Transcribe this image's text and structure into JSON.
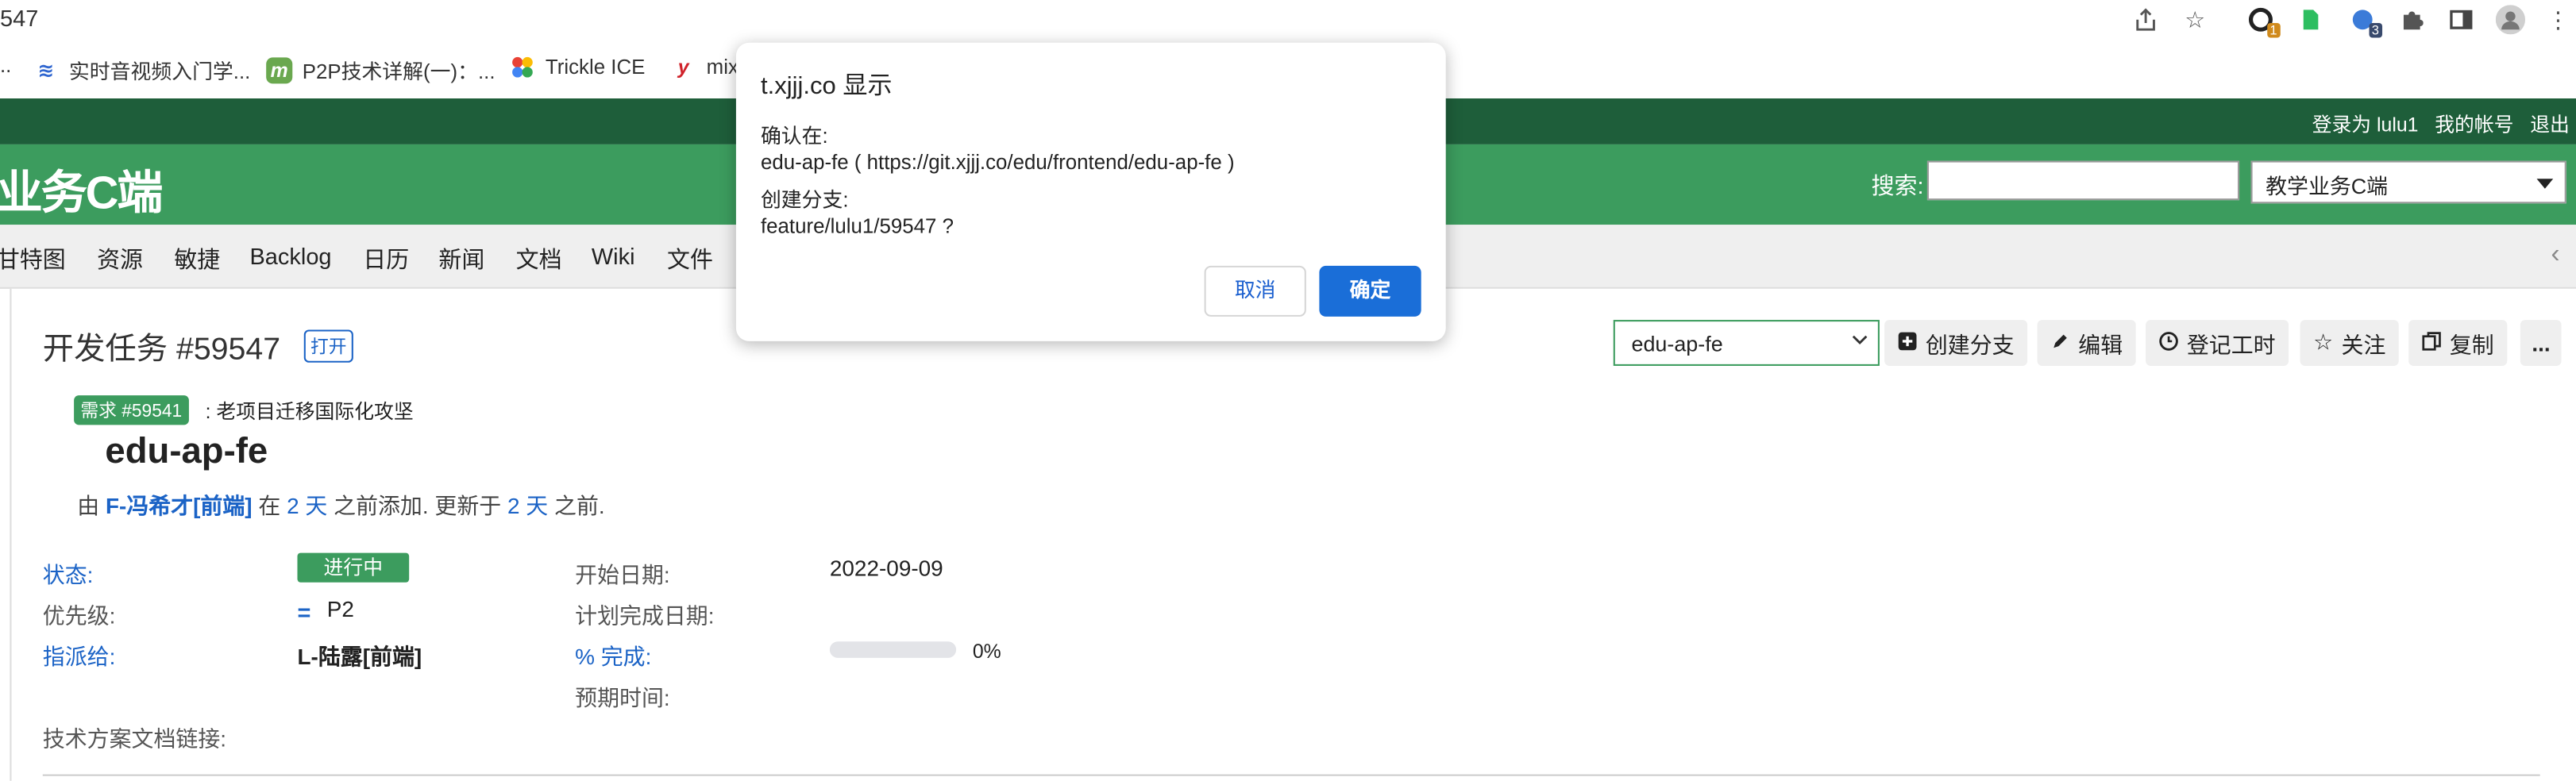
{
  "browser": {
    "url_fragment": "547",
    "extension_badges": [
      "1",
      "3"
    ]
  },
  "bookmarks": [
    {
      "label": "实时音视频入门学...",
      "icon": "layers-icon"
    },
    {
      "label": "P2P技术详解(一)：...",
      "icon": "m-logo-icon"
    },
    {
      "label": "Trickle ICE",
      "icon": "webrtc-logo-icon"
    },
    {
      "label": "mix",
      "icon": "y-logo-icon"
    }
  ],
  "account_bar": {
    "logged_in_as": "登录为 lulu1",
    "my_account": "我的帐号",
    "logout": "退出"
  },
  "header": {
    "project_title": "业务C端",
    "search_label": "搜索:",
    "search_value": "",
    "project_jump": "教学业务C端"
  },
  "main_menu": [
    "甘特图",
    "资源",
    "敏捷",
    "Backlog",
    "日历",
    "新闻",
    "文档",
    "Wiki",
    "文件"
  ],
  "issue": {
    "title": "开发任务 #59547",
    "status_tag": "打开",
    "parent_badge": "需求 #59541",
    "parent_subject": ": 老项目迁移国际化攻坚",
    "subject": "edu-ap-fe",
    "author_prefix": "由",
    "author": "F-冯希才[前端]",
    "added_prefix": "在",
    "added_ago": "2 天",
    "added_suffix": "之前添加. 更新于",
    "updated_ago": "2 天",
    "updated_suffix": "之前."
  },
  "actions": {
    "branch_select": "edu-ap-fe",
    "create_branch": "创建分支",
    "edit": "编辑",
    "log_time": "登记工时",
    "watch": "关注",
    "copy": "复制",
    "more": "..."
  },
  "attributes": {
    "status_label": "状态:",
    "status_value": "进行中",
    "priority_label": "优先级:",
    "priority_value": "P2",
    "assignee_label": "指派给:",
    "assignee_value": "L-陆露[前端]",
    "tech_doc_label": "技术方案文档链接:",
    "start_date_label": "开始日期:",
    "start_date_value": "2022-09-09",
    "due_date_label": "计划完成日期:",
    "done_label": "% 完成:",
    "done_percent": 0,
    "done_text": "0%",
    "estimated_label": "预期时间:"
  },
  "dialog": {
    "title": "t.xjjj.co 显示",
    "line1": "确认在:",
    "line2": "edu-ap-fe ( https://git.xjjj.co/edu/frontend/edu-ap-fe )",
    "line3": "创建分支:",
    "line4": "feature/lulu1/59547 ?",
    "cancel": "取消",
    "confirm": "确定"
  },
  "colors": {
    "header_green": "#3c9c5e",
    "top_bar_green": "#1e5e3a",
    "link_blue": "#1b63c6",
    "dialog_primary": "#1a6ed8"
  }
}
